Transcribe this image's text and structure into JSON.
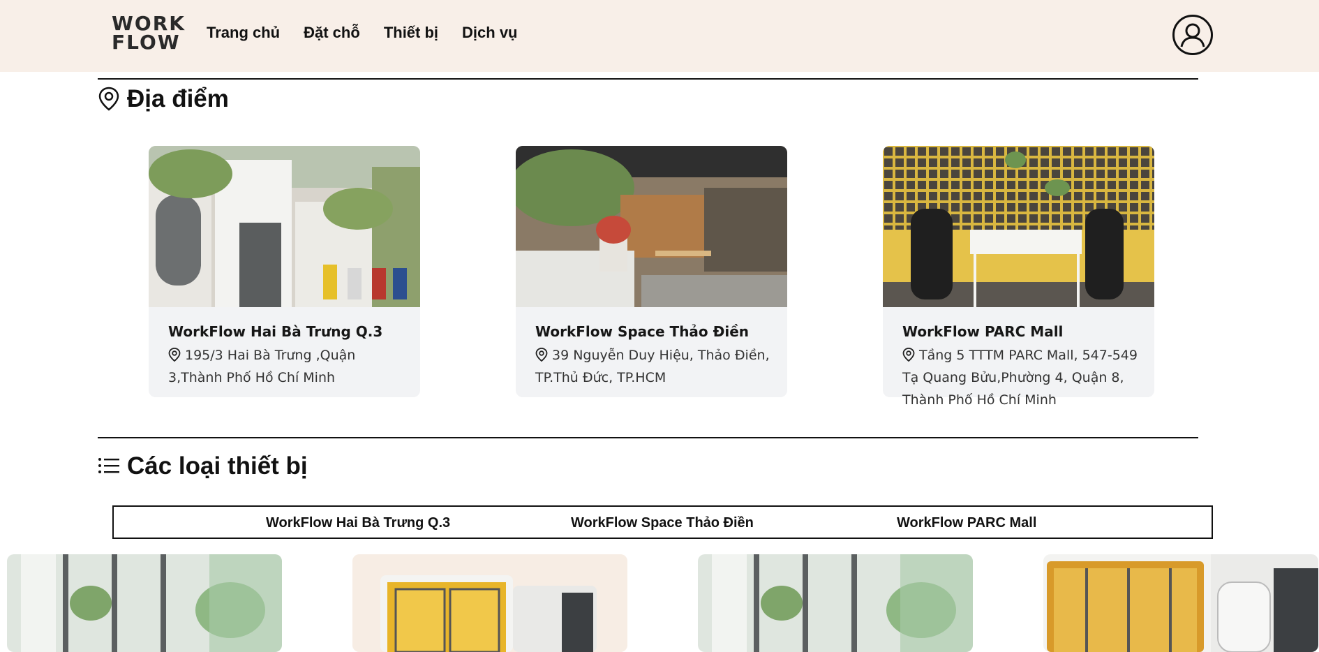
{
  "header": {
    "logo_line1": "WORK",
    "logo_line2": "FLOW",
    "nav": [
      "Trang chủ",
      "Đặt chỗ",
      "Thiết bị",
      "Dịch vụ"
    ]
  },
  "locations": {
    "title": "Địa điểm",
    "cards": [
      {
        "name": "WorkFlow Hai Bà Trưng Q.3",
        "address": "195/3 Hai Bà Trưng ,Quận 3,Thành Phố Hồ Chí Minh"
      },
      {
        "name": "WorkFlow Space Thảo Điền",
        "address": "39 Nguyễn Duy Hiệu, Thảo Điền, TP.Thủ Đức, TP.HCM"
      },
      {
        "name": "WorkFlow PARC Mall",
        "address": "Tầng 5 TTTM PARC Mall, 547-549 Tạ Quang Bửu,Phường 4, Quận 8, Thành Phố Hồ Chí Minh"
      }
    ]
  },
  "equipment": {
    "title": "Các loại thiết bị",
    "tabs": [
      "WorkFlow Hai Bà Trưng Q.3",
      "WorkFlow Space Thảo Điền",
      "WorkFlow PARC Mall"
    ]
  },
  "colors": {
    "header_bg": "#f8efe8",
    "card_bg": "#f2f3f5",
    "accent": "#f4c21a"
  }
}
